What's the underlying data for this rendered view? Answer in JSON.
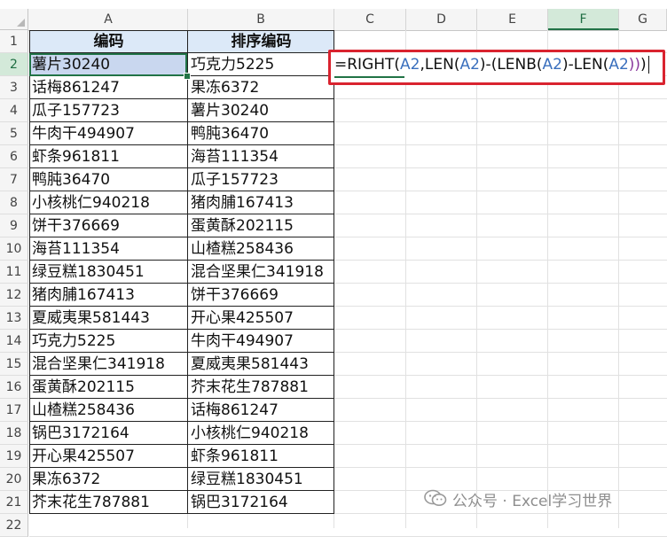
{
  "columns": [
    "A",
    "B",
    "C",
    "D",
    "E",
    "F",
    "G"
  ],
  "selected_column": "F",
  "rows": [
    "1",
    "2",
    "3",
    "4",
    "5",
    "6",
    "7",
    "8",
    "9",
    "10",
    "11",
    "12",
    "13",
    "14",
    "15",
    "16",
    "17",
    "18",
    "19",
    "20",
    "21",
    "22"
  ],
  "selected_row": "2",
  "table": {
    "headers": [
      "编码",
      "排序编码"
    ],
    "col_a": [
      "薯片30240",
      "话梅861247",
      "瓜子157723",
      "牛肉干494907",
      "虾条961811",
      "鸭肫36470",
      "小核桃仁940218",
      "饼干376669",
      "海苔111354",
      "绿豆糕1830451",
      "猪肉脯167413",
      "夏威夷果581443",
      "巧克力5225",
      "混合坚果仁341918",
      "蛋黄酥202115",
      "山楂糕258436",
      "锅巴3172164",
      "开心果425507",
      "果冻6372",
      "芥末花生787881"
    ],
    "col_b": [
      "巧克力5225",
      "果冻6372",
      "薯片30240",
      "鸭肫36470",
      "海苔111354",
      "瓜子157723",
      "猪肉脯167413",
      "蛋黄酥202115",
      "山楂糕258436",
      "混合坚果仁341918",
      "饼干376669",
      "开心果425507",
      "牛肉干494907",
      "夏威夷果581443",
      "芥末花生787881",
      "话梅861247",
      "小核桃仁940218",
      "虾条961811",
      "绿豆糕1830451",
      "锅巴3172164"
    ]
  },
  "formula": {
    "tokens": [
      {
        "t": "=RIGHT(",
        "c": "black"
      },
      {
        "t": "A2",
        "c": "blue"
      },
      {
        "t": ",LEN(",
        "c": "black"
      },
      {
        "t": "A2",
        "c": "blue"
      },
      {
        "t": ")-(LENB(",
        "c": "black"
      },
      {
        "t": "A2",
        "c": "blue"
      },
      {
        "t": ")-LEN(",
        "c": "black"
      },
      {
        "t": "A2",
        "c": "blue"
      },
      {
        "t": "))",
        "c": "purple"
      },
      {
        "t": ")",
        "c": "black"
      }
    ]
  },
  "watermark": {
    "text": "公众号 · Excel学习世界",
    "icon": "wechat-icon"
  },
  "colors": {
    "header_fill": "#dce9f8",
    "selection_green": "#217346",
    "highlight_red": "#d9232f",
    "ref_blue": "#3a6fbd"
  }
}
